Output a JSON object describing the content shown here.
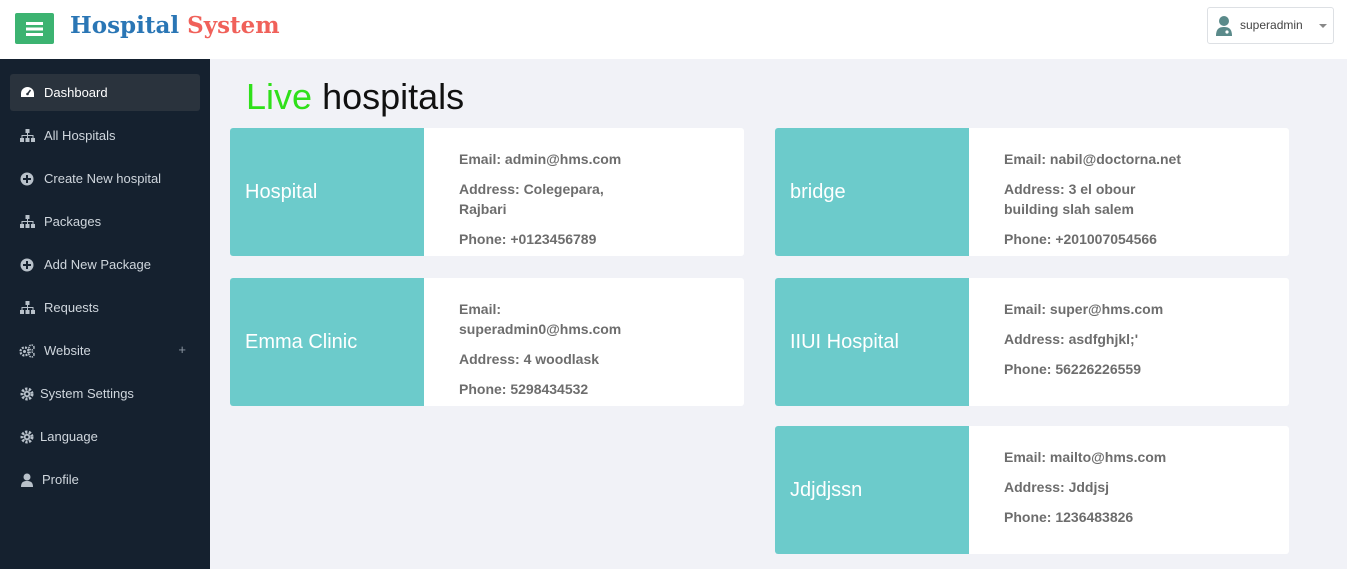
{
  "header": {
    "brand_part1": "Hospital",
    "brand_part2": "System",
    "user_name": "superadmin"
  },
  "sidebar": {
    "items": [
      {
        "label": "Dashboard",
        "icon": "dashboard-icon",
        "active": true
      },
      {
        "label": "All Hospitals",
        "icon": "sitemap-icon"
      },
      {
        "label": "Create New hospital",
        "icon": "plus-circle-icon"
      },
      {
        "label": "Packages",
        "icon": "sitemap-icon"
      },
      {
        "label": "Add New Package",
        "icon": "plus-circle-icon"
      },
      {
        "label": "Requests",
        "icon": "sitemap-icon"
      },
      {
        "label": "Website",
        "icon": "cogs-icon",
        "expand": "+"
      },
      {
        "label": "System Settings",
        "icon": "gear-icon"
      },
      {
        "label": "Language",
        "icon": "gear-icon"
      },
      {
        "label": "Profile",
        "icon": "user-icon"
      }
    ]
  },
  "main": {
    "title_part1": "Live",
    "title_part2": "hospitals",
    "hospitals": [
      {
        "name": "Hospital",
        "email": "Email: admin@hms.com",
        "address": "Address: Colegepara, Rajbari",
        "phone": "Phone: +0123456789"
      },
      {
        "name": "bridge",
        "email": "Email: nabil@doctorna.net",
        "address": "Address: 3 el obour building slah salem",
        "phone": "Phone: +201007054566"
      },
      {
        "name": "Emma Clinic",
        "email": "Email: superadmin0@hms.com",
        "address": "Address: 4 woodlask",
        "phone": "Phone: 5298434532"
      },
      {
        "name": "IIUI Hospital",
        "email": "Email: super@hms.com",
        "address": "Address: asdfghjkl;'",
        "phone": "Phone: 56226226559"
      },
      {
        "name": "Jdjdjssn",
        "email": "Email: mailto@hms.com",
        "address": "Address: Jddjsj",
        "phone": "Phone: 1236483826"
      }
    ]
  },
  "colors": {
    "menu_button": "#3cb371",
    "brand_blue": "#2a76b5",
    "brand_red": "#f0615a",
    "sidebar_bg": "#15212f",
    "title_green": "#2fe01a",
    "card_teal": "#6ccbcb"
  }
}
